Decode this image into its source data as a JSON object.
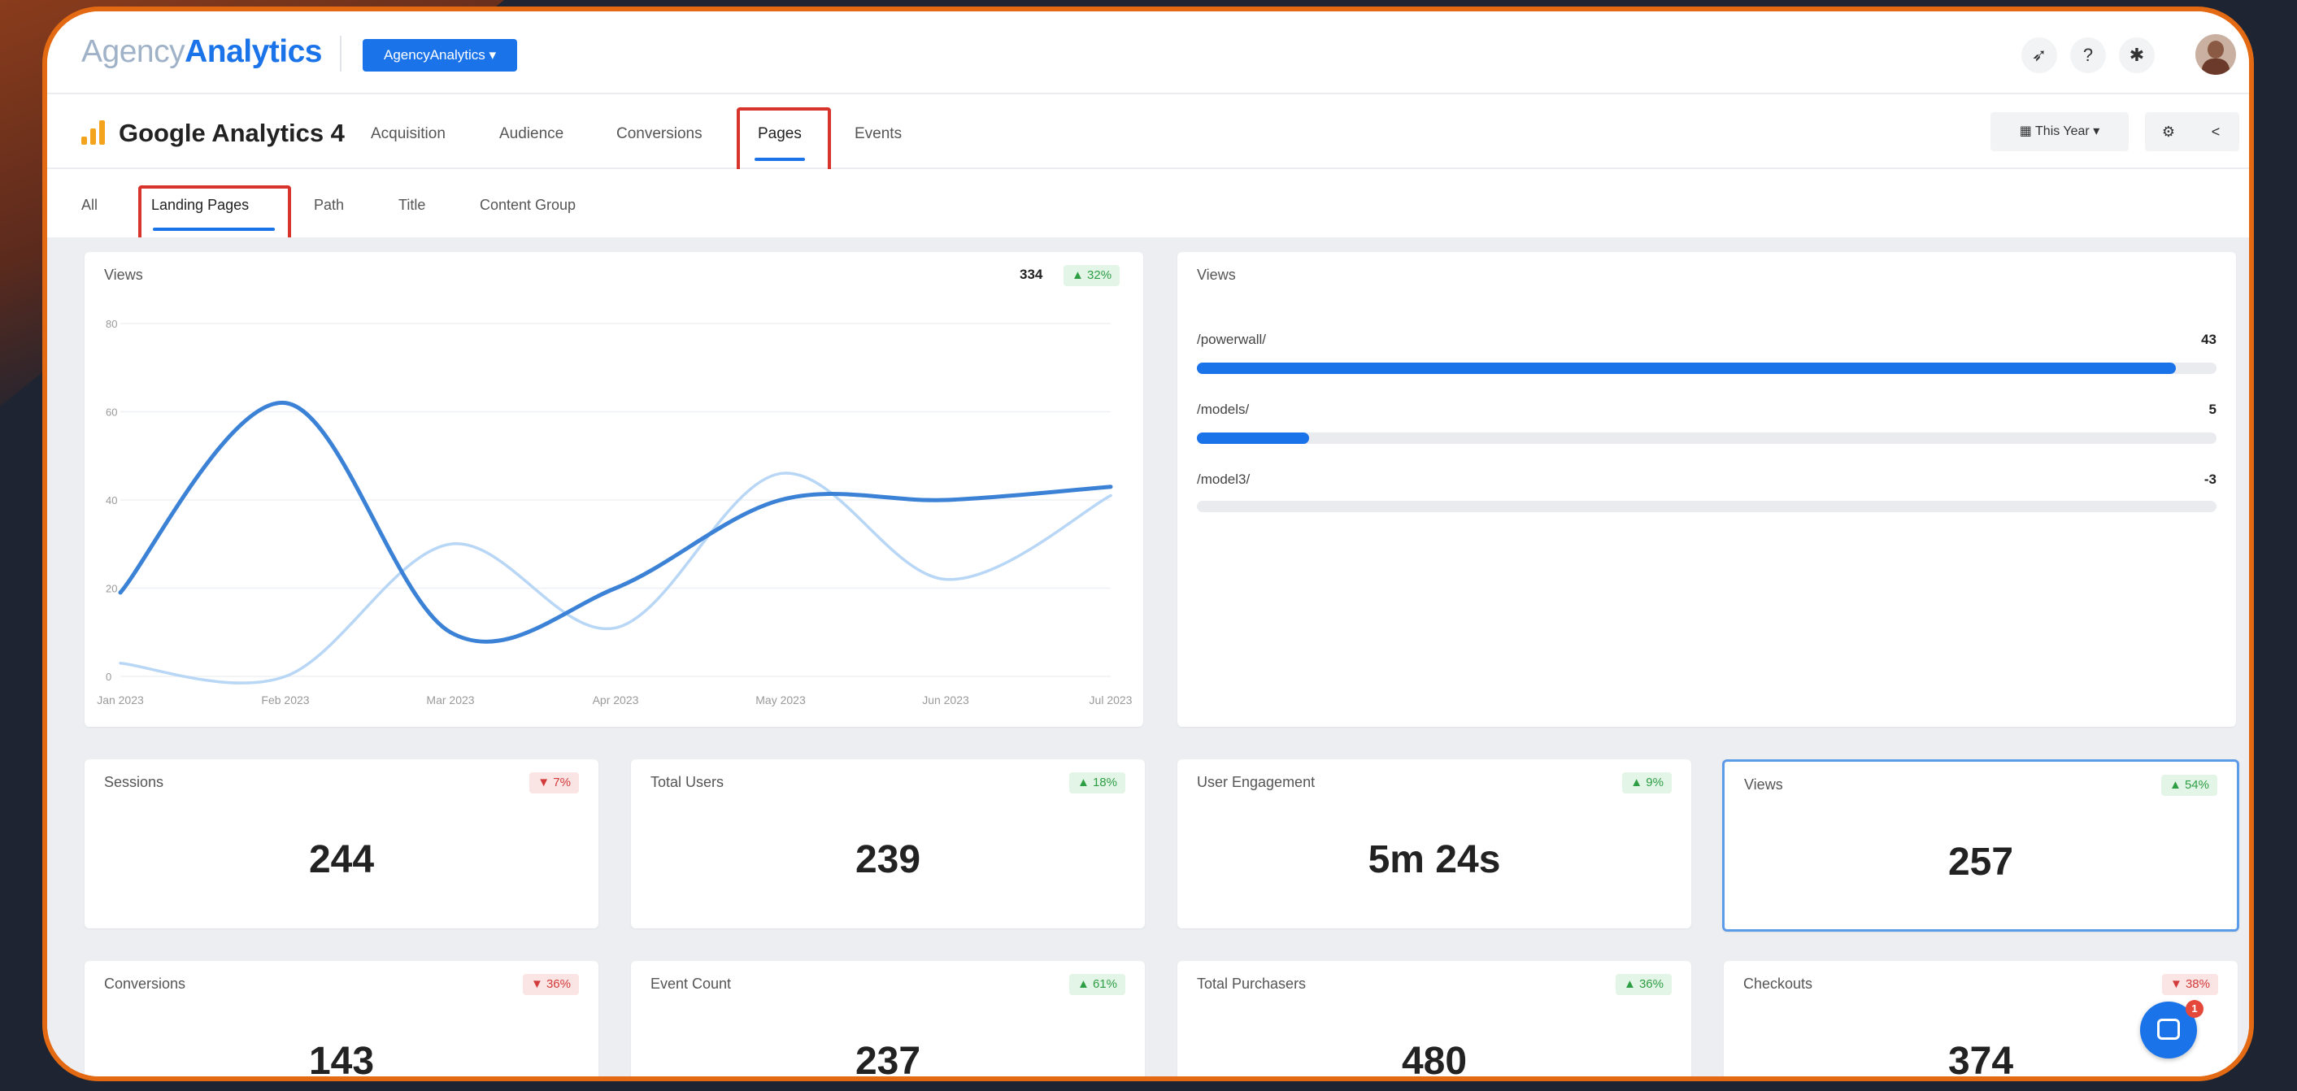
{
  "brand": {
    "logo_light": "Agency",
    "logo_bold": "Analytics",
    "account_button": "AgencyAnalytics ▾"
  },
  "top_icons": [
    "rocket-icon",
    "help-icon",
    "notifications-icon"
  ],
  "integration": {
    "title": "Google Analytics 4"
  },
  "nav_tabs": [
    {
      "label": "Acquisition"
    },
    {
      "label": "Audience"
    },
    {
      "label": "Conversions"
    },
    {
      "label": "Pages",
      "active": true
    },
    {
      "label": "Events"
    }
  ],
  "date_range": {
    "label": "This Year"
  },
  "sub_tabs": [
    {
      "label": "All"
    },
    {
      "label": "Landing Pages",
      "active": true
    },
    {
      "label": "Path"
    },
    {
      "label": "Title"
    },
    {
      "label": "Content Group"
    }
  ],
  "line_chart_card": {
    "title": "Views",
    "total": "334",
    "change": "▲ 32%"
  },
  "chart_data": {
    "type": "line",
    "title": "",
    "xlabel": "",
    "ylabel": "",
    "categories": [
      "Jan 2023",
      "Feb 2023",
      "Mar 2023",
      "Apr 2023",
      "May 2023",
      "Jun 2023",
      "Jul 2023"
    ],
    "ylim": [
      0,
      80
    ],
    "yticks": [
      0,
      20,
      40,
      60,
      80
    ],
    "grid": true,
    "series": [
      {
        "values": [
          19,
          62,
          10,
          20,
          40,
          40,
          43
        ],
        "color": "#3b82d6"
      },
      {
        "values": [
          3,
          0,
          30,
          11,
          46,
          22,
          41
        ],
        "color": "#b8d6f5"
      }
    ]
  },
  "bar_card": {
    "title": "Views",
    "rows": [
      {
        "label": "/powerwall/",
        "value": "43",
        "fraction": 0.96
      },
      {
        "label": "/models/",
        "value": "5",
        "fraction": 0.11
      },
      {
        "label": "/model3/",
        "value": "-3",
        "fraction": 0
      }
    ]
  },
  "metrics": [
    {
      "label": "Sessions",
      "value": "244",
      "change": "▼ 7%",
      "direction": "down"
    },
    {
      "label": "Total Users",
      "value": "239",
      "change": "▲ 18%",
      "direction": "up"
    },
    {
      "label": "User Engagement",
      "value": "5m 24s",
      "change": "▲ 9%",
      "direction": "up"
    },
    {
      "label": "Views",
      "value": "257",
      "change": "▲ 54%",
      "direction": "up"
    },
    {
      "label": "Conversions",
      "value": "143",
      "change": "▼ 36%",
      "direction": "down"
    },
    {
      "label": "Event Count",
      "value": "237",
      "change": "▲ 61%",
      "direction": "up"
    },
    {
      "label": "Total Purchasers",
      "value": "480",
      "change": "▲ 36%",
      "direction": "up"
    },
    {
      "label": "Checkouts",
      "value": "374",
      "change": "▼ 38%",
      "direction": "down"
    }
  ],
  "chat": {
    "unread": "1"
  }
}
